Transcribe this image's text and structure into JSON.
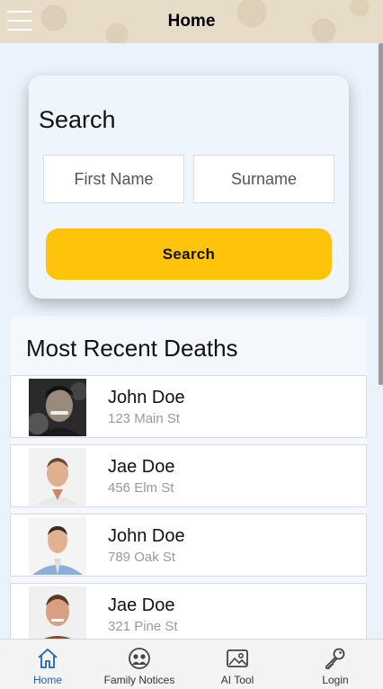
{
  "header": {
    "title": "Home",
    "menu_icon": "hamburger-icon"
  },
  "search": {
    "title": "Search",
    "first_name_placeholder": "First Name",
    "surname_placeholder": "Surname",
    "button_label": "Search",
    "button_color": "#fec30b"
  },
  "recent": {
    "title": "Most Recent Deaths",
    "items": [
      {
        "name": "John Doe",
        "address": "123 Main St",
        "photo": "portrait-photo"
      },
      {
        "name": "Jae Doe",
        "address": "456 Elm St",
        "photo": "portrait-photo"
      },
      {
        "name": "John Doe",
        "address": "789 Oak St",
        "photo": "portrait-photo"
      },
      {
        "name": "Jae Doe",
        "address": "321 Pine St",
        "photo": "portrait-photo"
      }
    ]
  },
  "nav": {
    "items": [
      {
        "label": "Home",
        "icon": "home-icon",
        "active": true
      },
      {
        "label": "Family Notices",
        "icon": "family-icon",
        "active": false
      },
      {
        "label": "AI Tool",
        "icon": "image-icon",
        "active": false
      },
      {
        "label": "Login",
        "icon": "key-icon",
        "active": false
      }
    ],
    "active_color": "#1d5fc6"
  }
}
